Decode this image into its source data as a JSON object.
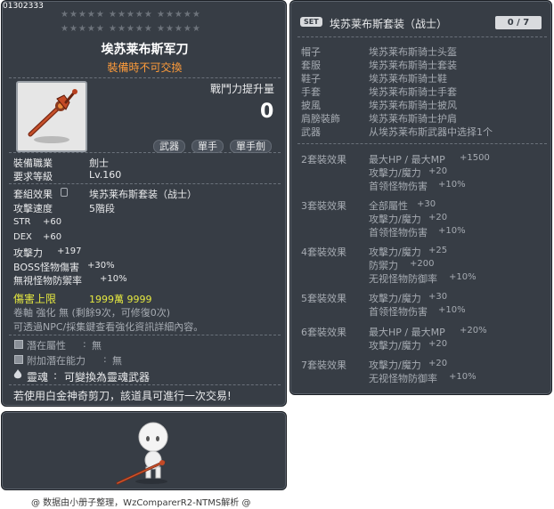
{
  "item_id": "01302333",
  "item": {
    "name": "埃苏莱布斯军刀",
    "trade_note": "裝備時不可交換",
    "power_label": "戰鬥力提升量",
    "power_value": "0",
    "tags": [
      "武器",
      "單手",
      "單手劍"
    ],
    "job_label": "裝備職業",
    "job_value": "劍士",
    "level_label": "要求等級",
    "level_value": "Lv.160",
    "stats": [
      {
        "label": "套組效果",
        "value": "埃苏莱布斯套装（战士）"
      },
      {
        "label": "攻擊速度",
        "value": "5階段"
      },
      {
        "label": "STR",
        "value": "+60"
      },
      {
        "label": "DEX",
        "value": "+60"
      },
      {
        "label": "攻擊力",
        "value": "+197"
      },
      {
        "label": "BOSS怪物傷害",
        "value": "+30%"
      },
      {
        "label": "無視怪物防禦率",
        "value": "+10%"
      }
    ],
    "damage_cap_label": "傷害上限",
    "damage_cap_value": "1999萬 9999",
    "scroll_text": "卷軸 強化 無 (剩餘9次，可修復0次)",
    "npc_text": "可透過NPC/採集鍵查看強化資訊詳細內容。",
    "potential_label": "潛在屬性",
    "potential_value": "無",
    "bonus_label": "附加潛在能力",
    "bonus_value": "無",
    "soul_label": "靈魂",
    "soul_text": "可變換為靈魂武器",
    "shears_text": "若使用白金神奇剪刀，該道具可進行一次交易!"
  },
  "set": {
    "badge": "SET",
    "title": "埃苏莱布斯套装（战士）",
    "count": "0 / 7",
    "pieces": [
      {
        "slot": "帽子",
        "name": "埃苏莱布斯骑士头盔"
      },
      {
        "slot": "套服",
        "name": "埃苏莱布斯骑士套装"
      },
      {
        "slot": "鞋子",
        "name": "埃苏莱布斯骑士鞋"
      },
      {
        "slot": "手套",
        "name": "埃苏莱布斯骑士手套"
      },
      {
        "slot": "披風",
        "name": "埃苏莱布斯骑士披风"
      },
      {
        "slot": "肩膀裝飾",
        "name": "埃苏莱布斯骑士护肩"
      },
      {
        "slot": "武器",
        "name": "从埃苏莱布斯武器中选择1个"
      }
    ],
    "effects": [
      {
        "label": "2套裝效果",
        "lines": [
          [
            "最大HP / 最大MP",
            "+1500"
          ],
          [
            "攻擊力/魔力",
            "+20"
          ],
          [
            "首领怪物伤害",
            "+10%"
          ]
        ]
      },
      {
        "label": "3套裝效果",
        "lines": [
          [
            "全部屬性",
            "+30"
          ],
          [
            "攻擊力/魔力",
            "+20"
          ],
          [
            "首领怪物伤害",
            "+10%"
          ]
        ]
      },
      {
        "label": "4套裝效果",
        "lines": [
          [
            "攻擊力/魔力",
            "+25"
          ],
          [
            "防禦力",
            "+200"
          ],
          [
            "无视怪物防御率",
            "+10%"
          ]
        ]
      },
      {
        "label": "5套裝效果",
        "lines": [
          [
            "攻擊力/魔力",
            "+30"
          ],
          [
            "首领怪物伤害",
            "+10%"
          ]
        ]
      },
      {
        "label": "6套裝效果",
        "lines": [
          [
            "最大HP / 最大MP",
            "+20%"
          ],
          [
            "攻擊力/魔力",
            "+20"
          ]
        ]
      },
      {
        "label": "7套裝效果",
        "lines": [
          [
            "攻擊力/魔力",
            "+20"
          ],
          [
            "无视怪物防御率",
            "+10%"
          ]
        ]
      }
    ]
  },
  "footer": "@ 数据由小册子整理，WzComparerR2-NTMS解析 @",
  "colors": {
    "panel": "#373d45",
    "yellow": "#e5e840",
    "orange": "#ff9c3a"
  }
}
